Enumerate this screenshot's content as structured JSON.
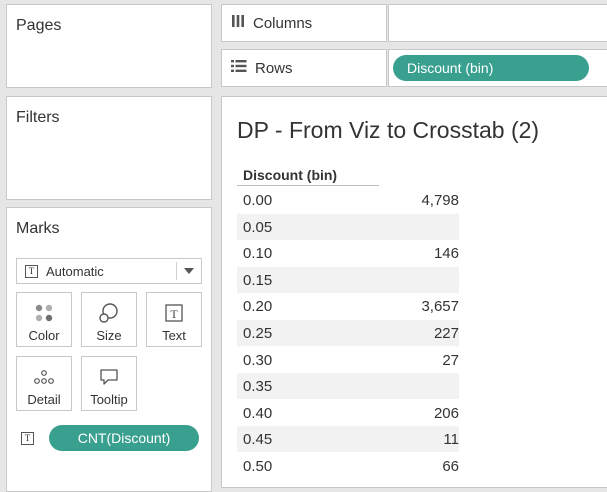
{
  "sidebar": {
    "pages_title": "Pages",
    "filters_title": "Filters",
    "marks_title": "Marks",
    "mark_type": "Automatic",
    "mark_buttons": [
      {
        "label": "Color",
        "icon": "color-dots-icon"
      },
      {
        "label": "Size",
        "icon": "size-shapes-icon"
      },
      {
        "label": "Text",
        "icon": "text-t-icon"
      },
      {
        "label": "Detail",
        "icon": "detail-dots-icon"
      },
      {
        "label": "Tooltip",
        "icon": "tooltip-bubble-icon"
      }
    ],
    "mark_field": "CNT(Discount)"
  },
  "shelves": {
    "columns_label": "Columns",
    "rows_label": "Rows",
    "rows_pill": "Discount (bin)"
  },
  "view": {
    "title": "DP - From Viz to Crosstab (2)",
    "column_header": "Discount (bin)",
    "rows": [
      {
        "bin": "0.00",
        "value": "4,798"
      },
      {
        "bin": "0.05",
        "value": ""
      },
      {
        "bin": "0.10",
        "value": "146"
      },
      {
        "bin": "0.15",
        "value": ""
      },
      {
        "bin": "0.20",
        "value": "3,657"
      },
      {
        "bin": "0.25",
        "value": "227"
      },
      {
        "bin": "0.30",
        "value": "27"
      },
      {
        "bin": "0.35",
        "value": ""
      },
      {
        "bin": "0.40",
        "value": "206"
      },
      {
        "bin": "0.45",
        "value": "11"
      },
      {
        "bin": "0.50",
        "value": "66"
      }
    ]
  },
  "colors": {
    "pill": "#39a08f",
    "row_band": "#f2f2f2"
  }
}
